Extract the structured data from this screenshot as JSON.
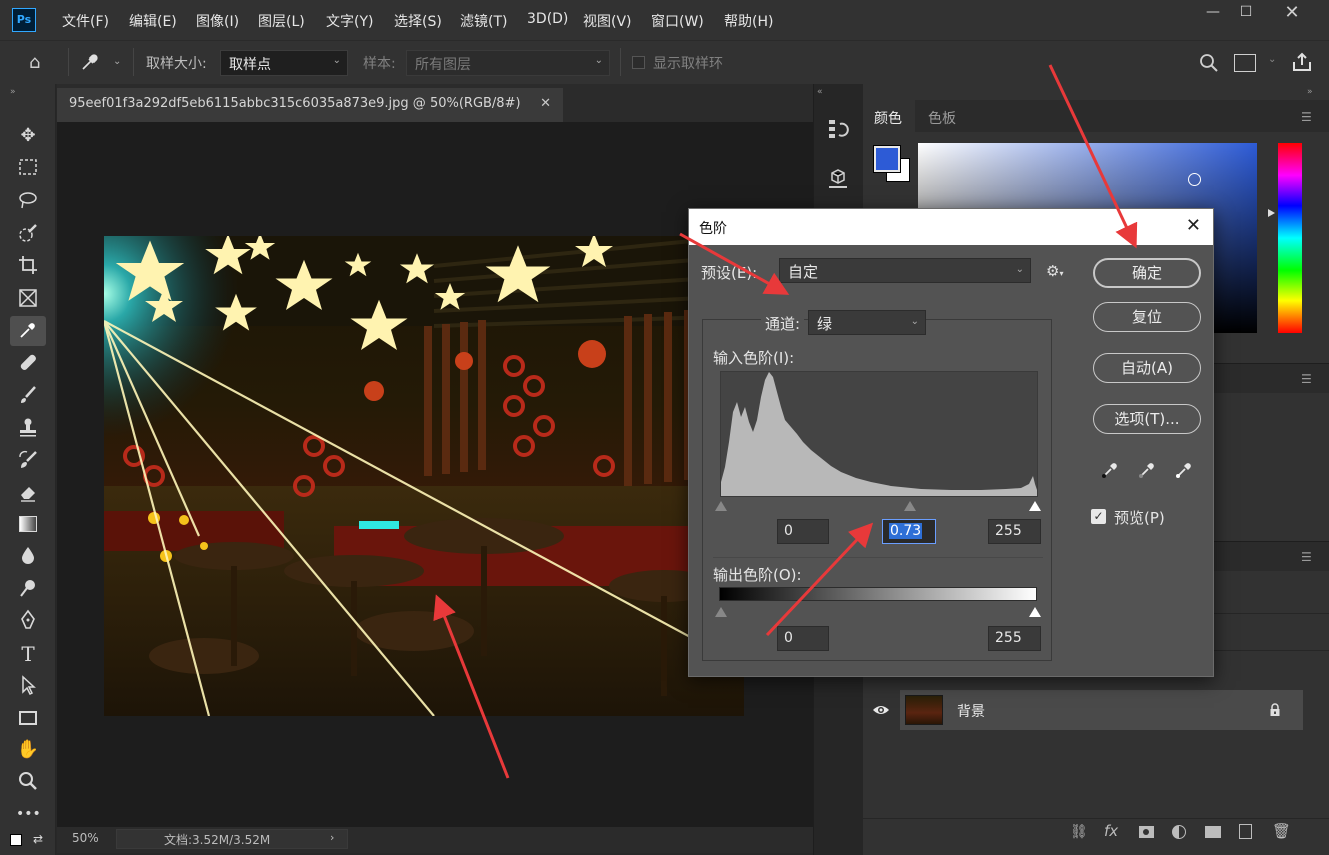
{
  "app": {
    "logo": "Ps",
    "menu": [
      "文件(F)",
      "编辑(E)",
      "图像(I)",
      "图层(L)",
      "文字(Y)",
      "选择(S)",
      "滤镜(T)",
      "3D(D)",
      "视图(V)",
      "窗口(W)",
      "帮助(H)"
    ]
  },
  "options_bar": {
    "sample_size_label": "取样大小:",
    "sample_size_value": "取样点",
    "sample_label": "样本:",
    "sample_value": "所有图层",
    "show_ring_label": "显示取样环"
  },
  "document": {
    "tab_title": "95eef01f3a292df5eb6115abbc315c6035a873e9.jpg @ 50%(RGB/8#)",
    "zoom": "50%",
    "doc_size": "文档:3.52M/3.52M"
  },
  "right_panel": {
    "tabs": [
      "颜色",
      "色板"
    ],
    "colors": {
      "foreground": "#2d5bd6",
      "background": "#ffffff"
    },
    "layer_name": "背景"
  },
  "levels_dialog": {
    "title": "色阶",
    "preset_label": "预设(E):",
    "preset_value": "自定",
    "channel_label": "通道:",
    "channel_value": "绿",
    "input_levels_label": "输入色阶(I):",
    "input_black": "0",
    "input_gamma": "0.73",
    "input_white": "255",
    "output_levels_label": "输出色阶(O):",
    "output_black": "0",
    "output_white": "255",
    "buttons": {
      "ok": "确定",
      "reset": "复位",
      "auto": "自动(A)",
      "options": "选项(T)..."
    },
    "preview_label": "预览(P)",
    "preview_checked": true
  },
  "annotation_color": "#e8393a"
}
